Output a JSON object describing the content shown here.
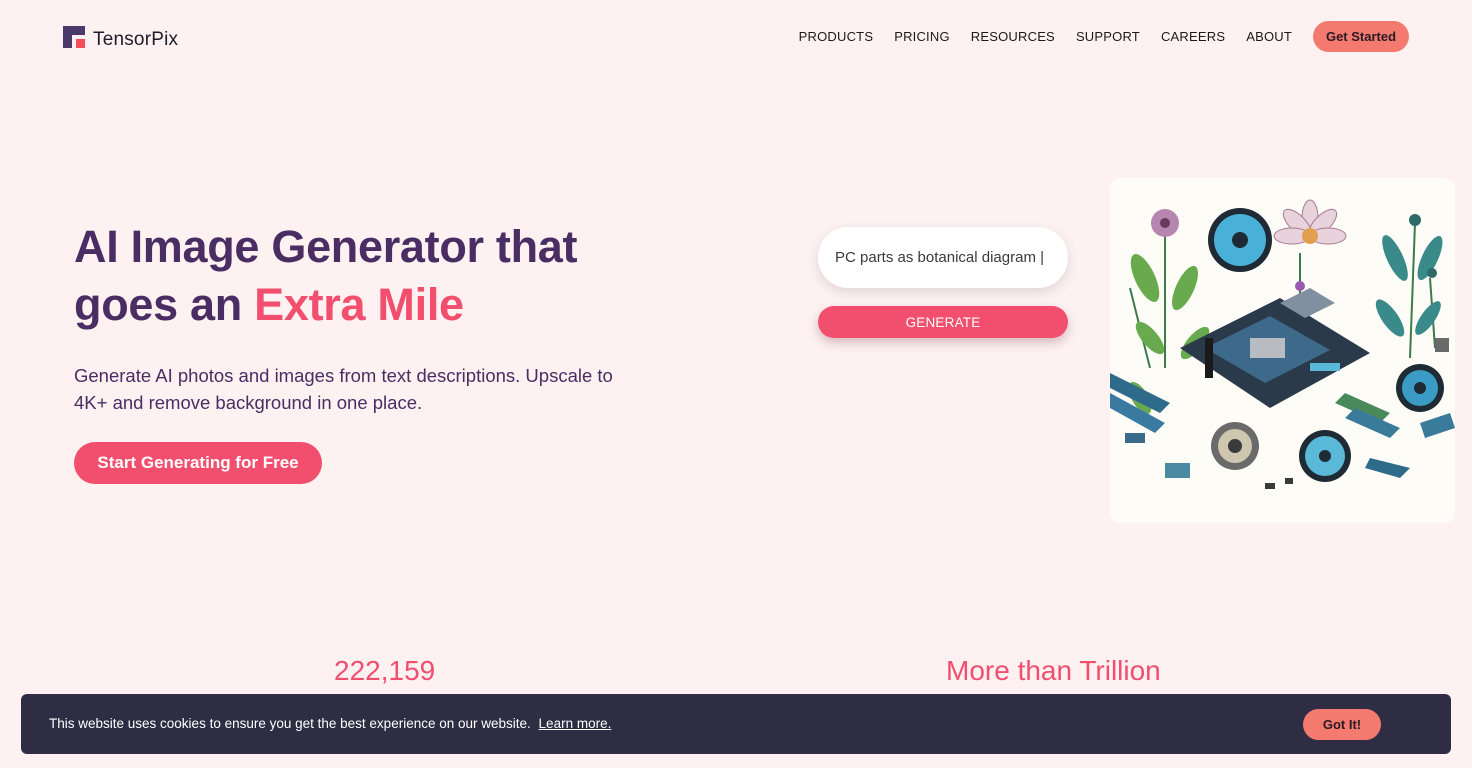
{
  "brand": {
    "name": "TensorPix",
    "accent": "#f24e6e",
    "primary": "#4a2d63",
    "button_coral": "#f47a70"
  },
  "nav": {
    "items": [
      {
        "label": "PRODUCTS"
      },
      {
        "label": "PRICING"
      },
      {
        "label": "RESOURCES"
      },
      {
        "label": "SUPPORT"
      },
      {
        "label": "CAREERS"
      },
      {
        "label": "ABOUT"
      }
    ],
    "cta_label": "Get Started"
  },
  "hero": {
    "title_line1": "AI Image Generator that",
    "title_line2_prefix": "goes an ",
    "title_line2_accent": "Extra Mile",
    "subtitle": "Generate AI photos and images from text descriptions. Upscale to 4K+ and remove background in one place.",
    "cta_label": "Start Generating for Free"
  },
  "generator": {
    "prompt_value": "PC parts as botanical diagram |",
    "generate_label": "GENERATE",
    "illustration_icon": "pc-parts-botanical-illustration"
  },
  "stats": [
    {
      "value": "222,159"
    },
    {
      "value": "More than Trillion"
    }
  ],
  "cookie_banner": {
    "text": "This website uses cookies to ensure you get the best experience on our website.",
    "link_label": "Learn more.",
    "button_label": "Got It!"
  }
}
